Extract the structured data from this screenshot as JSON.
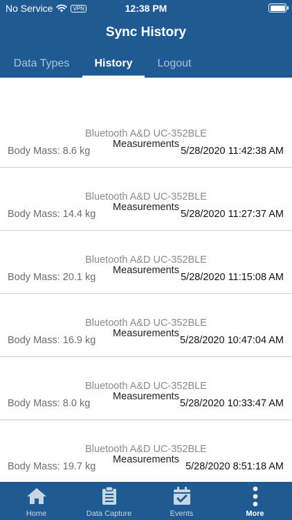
{
  "status_bar": {
    "carrier": "No Service",
    "vpn": "VPN",
    "time": "12:38 PM"
  },
  "header": {
    "title": "Sync History"
  },
  "tabs": [
    {
      "label": "Data Types",
      "active": false
    },
    {
      "label": "History",
      "active": true
    },
    {
      "label": "Logout",
      "active": false
    }
  ],
  "records": [
    {
      "title": "Measurements",
      "device": "Bluetooth A&D UC-352BLE",
      "value": "Body Mass: 8.6 kg",
      "date": "5/28/2020 11:42:38 AM"
    },
    {
      "title": "Measurements",
      "device": "Bluetooth A&D UC-352BLE",
      "value": "Body Mass: 14.4 kg",
      "date": "5/28/2020 11:27:37 AM"
    },
    {
      "title": "Measurements",
      "device": "Bluetooth A&D UC-352BLE",
      "value": "Body Mass: 20.1 kg",
      "date": "5/28/2020 11:15:08 AM"
    },
    {
      "title": "Measurements",
      "device": "Bluetooth A&D UC-352BLE",
      "value": "Body Mass: 16.9 kg",
      "date": "5/28/2020 10:47:04 AM"
    },
    {
      "title": "Measurements",
      "device": "Bluetooth A&D UC-352BLE",
      "value": "Body Mass: 8.0 kg",
      "date": "5/28/2020 10:33:47 AM"
    },
    {
      "title": "Measurements",
      "device": "Bluetooth A&D UC-352BLE",
      "value": "Body Mass: 19.7 kg",
      "date": "5/28/2020 8:51:18 AM"
    }
  ],
  "bottom_nav": [
    {
      "label": "Home",
      "icon": "home-icon",
      "active": false
    },
    {
      "label": "Data Capture",
      "icon": "clipboard-icon",
      "active": false
    },
    {
      "label": "Events",
      "icon": "calendar-check-icon",
      "active": false
    },
    {
      "label": "More",
      "icon": "more-vertical-icon",
      "active": true
    }
  ],
  "colors": {
    "brand": "#1f5b92",
    "divider": "#cfcfcf",
    "secondary_text": "#8a8a8a"
  }
}
